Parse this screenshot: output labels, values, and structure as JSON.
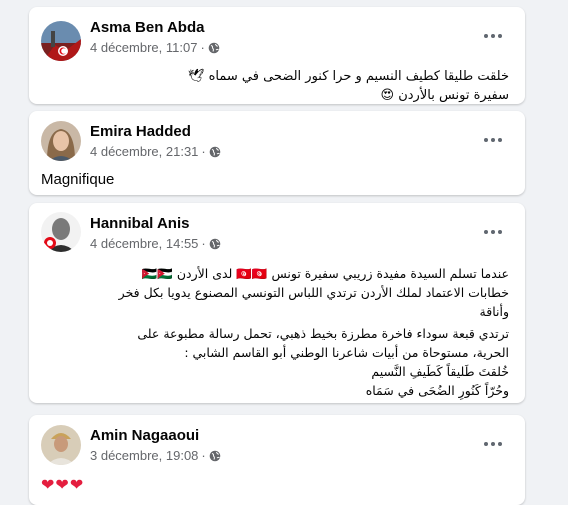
{
  "posts": [
    {
      "author": "Asma Ben Abda",
      "date": "4 décembre, 11:07",
      "separator": "·",
      "avatar_icon": "tunisia-flag-avatar",
      "lines": [
        "خلقت طليقا كطيف النسيم و حرا كنور الضحى في سماه 🕊",
        "سفيرة تونس بالأردن 😍"
      ]
    },
    {
      "author": "Emira Hadded",
      "date": "4 décembre, 21:31",
      "separator": "·",
      "avatar_icon": "woman-portrait-avatar",
      "lines": [
        "Magnifique"
      ]
    },
    {
      "author": "Hannibal Anis",
      "date": "4 décembre, 14:55",
      "separator": "·",
      "avatar_icon": "man-portrait-avatar",
      "lines": [
        "عندما تسلم السيدة مفيدة زريبي سفيرة تونس 🇹🇳🇹🇳 لدى الأردن 🇯🇴🇯🇴",
        "خطابات الاعتماد لملك الأردن ترتدي اللباس التونسي المصنوع يدويا بكل فخر",
        "وأناقة",
        "ترتدي قبعة سوداء فاخرة مطرزة بخيط ذهبي، تحمل رسالة مطبوعة على",
        "الحرية، مستوحاة من أبيات شاعرنا الوطني أبو القاسم الشابي :",
        "خُلقتَ طَليقاً كَطَيفِ النَّسيم",
        "وحُرّاً كَنُورِ الضُحَى في سَمَاه"
      ]
    },
    {
      "author": "Amin Nagaaoui",
      "date": "3 décembre, 19:08",
      "separator": "·",
      "avatar_icon": "man-portrait-avatar",
      "lines": [
        "❤❤❤"
      ]
    }
  ],
  "icons": {
    "privacy": "globe-icon",
    "menu": "more-options-icon"
  }
}
